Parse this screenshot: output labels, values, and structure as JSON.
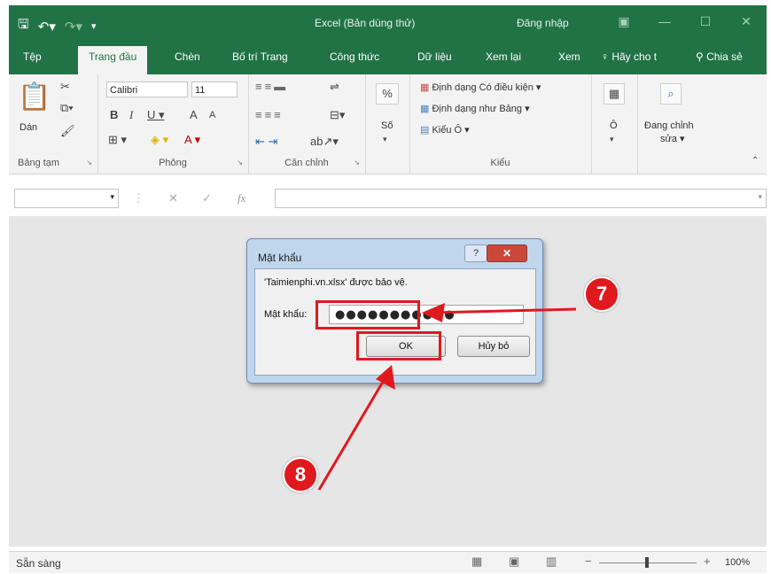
{
  "titlebar": {
    "title": "Excel (Bản dùng thử)",
    "signin": "Đăng nhập"
  },
  "tabs": [
    {
      "label": "Tệp"
    },
    {
      "label": "Trang đầu"
    },
    {
      "label": "Chèn"
    },
    {
      "label": "Bố trí Trang"
    },
    {
      "label": "Công thức"
    },
    {
      "label": "Dữ liệu"
    },
    {
      "label": "Xem lại"
    },
    {
      "label": "Xem"
    },
    {
      "label": "Hãy cho t"
    },
    {
      "label": "Chia sẻ"
    }
  ],
  "ribbon": {
    "clipboard": {
      "paste": "Dán",
      "group": "Bảng tạm"
    },
    "font": {
      "name": "Calibri",
      "size": "11",
      "group": "Phông"
    },
    "alignment": {
      "group": "Căn chỉnh"
    },
    "number": {
      "label": "Số",
      "symbol": "%"
    },
    "styles": {
      "conditional": "Định dạng Có điều kiện",
      "format_table": "Định dạng như Bảng",
      "cell_styles": "Kiểu Ô",
      "group": "Kiểu"
    },
    "cells": {
      "label": "Ô"
    },
    "editing": {
      "label_line1": "Đang chỉnh",
      "label_line2": "sửa"
    }
  },
  "formula_bar": {
    "fx": "fx"
  },
  "dialog": {
    "title": "Mật khẩu",
    "help": "?",
    "close": "✕",
    "message": "'Taimienphi.vn.xlsx' được bảo vệ.",
    "password_label": "Mật khẩu:",
    "password_value": "●●●●●●●●●●●",
    "ok_label": "OK",
    "cancel_label": "Hủy bỏ"
  },
  "annotations": {
    "step7": "7",
    "step8": "8"
  },
  "status": {
    "ready": "Sẵn sàng",
    "zoom": "100%"
  },
  "colors": {
    "excel_green": "#217346",
    "annotation_red": "#e0191f"
  }
}
